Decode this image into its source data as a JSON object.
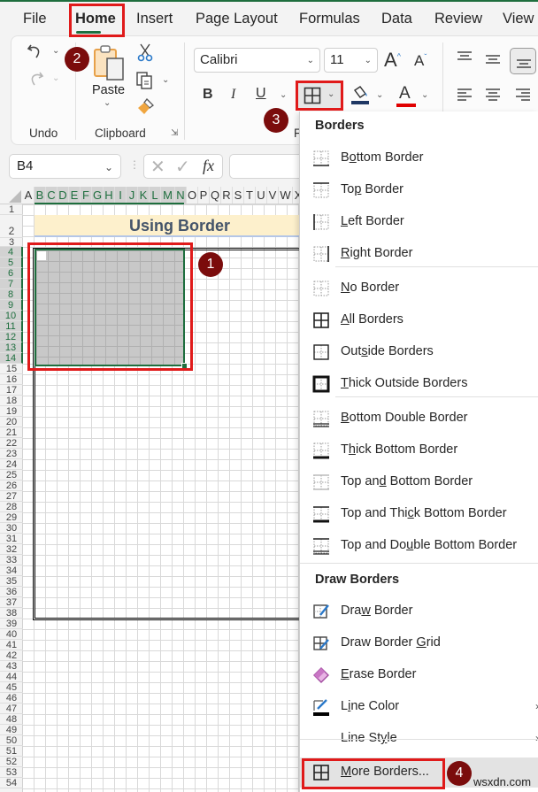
{
  "ribbon_tabs": [
    {
      "label": "File"
    },
    {
      "label": "Home",
      "active": true
    },
    {
      "label": "Insert"
    },
    {
      "label": "Page Layout"
    },
    {
      "label": "Formulas"
    },
    {
      "label": "Data"
    },
    {
      "label": "Review"
    },
    {
      "label": "View"
    }
  ],
  "ribbon": {
    "undo_group_label": "Undo",
    "clipboard_group_label": "Clipboard",
    "paste_label": "Paste",
    "font_name": "Calibri",
    "font_size": "11",
    "font_group_label_partial": "F",
    "icons": {
      "undo": "undo-icon",
      "redo": "redo-icon",
      "paste": "paste-icon",
      "cut": "scissors-icon",
      "copy": "copy-icon",
      "format_painter": "paintbrush-icon",
      "increase_font": "increase-font-size-icon",
      "decrease_font": "decrease-font-size-icon",
      "bold": "B",
      "italic": "I",
      "underline": "U",
      "borders": "borders-icon",
      "fill_color": "fill-color-icon",
      "font_color": "A"
    },
    "fill_color": "#1f3864",
    "font_color": "#e00000"
  },
  "formula_bar": {
    "name_box": "B4",
    "fx_label": "fx",
    "formula_value": ""
  },
  "sheet": {
    "columns": [
      "A",
      "B",
      "C",
      "D",
      "E",
      "F",
      "G",
      "H",
      "I",
      "J",
      "K",
      "L",
      "M",
      "N",
      "O",
      "P",
      "Q",
      "R",
      "S",
      "T",
      "U",
      "V",
      "W",
      "X"
    ],
    "selected_columns": [
      "B",
      "C",
      "D",
      "E",
      "F",
      "G",
      "H",
      "I",
      "J",
      "K",
      "L",
      "M",
      "N"
    ],
    "rows": [
      "1",
      "2",
      "3",
      "4",
      "5",
      "6",
      "7",
      "8",
      "9",
      "10",
      "11",
      "12",
      "13",
      "14",
      "15",
      "16",
      "17",
      "18",
      "19",
      "20",
      "21",
      "22",
      "23",
      "24",
      "25",
      "26",
      "27",
      "28",
      "29",
      "30",
      "31",
      "32",
      "33",
      "34",
      "35",
      "36",
      "37",
      "38",
      "39",
      "40",
      "41",
      "42",
      "43",
      "44",
      "45",
      "46",
      "47",
      "48",
      "49",
      "50",
      "51",
      "52",
      "53",
      "54"
    ],
    "selected_rows": [
      "4",
      "5",
      "6",
      "7",
      "8",
      "9",
      "10",
      "11",
      "12",
      "13",
      "14"
    ],
    "title_cell": "Using Border",
    "title_fill": "#fdf0cc",
    "selection_range_active": "B4"
  },
  "borders_menu": {
    "section1_header": "Borders",
    "section1_items": [
      {
        "pre": "B",
        "u": "o",
        "post": "ttom Border",
        "icon": "bottom-border-icon"
      },
      {
        "pre": "To",
        "u": "p",
        "post": " Border",
        "icon": "top-border-icon"
      },
      {
        "pre": "",
        "u": "L",
        "post": "eft Border",
        "icon": "left-border-icon"
      },
      {
        "pre": "",
        "u": "R",
        "post": "ight Border",
        "icon": "right-border-icon"
      }
    ],
    "section2_items": [
      {
        "pre": "",
        "u": "N",
        "post": "o Border",
        "icon": "no-border-icon"
      },
      {
        "pre": "",
        "u": "A",
        "post": "ll Borders",
        "icon": "all-borders-icon"
      },
      {
        "pre": "Out",
        "u": "s",
        "post": "ide Borders",
        "icon": "outside-borders-icon"
      },
      {
        "pre": "",
        "u": "T",
        "post": "hick Outside Borders",
        "icon": "thick-outside-borders-icon"
      }
    ],
    "section3_items": [
      {
        "pre": "",
        "u": "B",
        "post": "ottom Double Border",
        "icon": "bottom-double-border-icon"
      },
      {
        "pre": "T",
        "u": "h",
        "post": "ick Bottom Border",
        "icon": "thick-bottom-border-icon"
      },
      {
        "pre": "Top an",
        "u": "d",
        "post": " Bottom Border",
        "icon": "top-and-bottom-border-icon"
      },
      {
        "pre": "Top and Thi",
        "u": "c",
        "post": "k Bottom Border",
        "icon": "top-and-thick-bottom-border-icon"
      },
      {
        "pre": "Top and Do",
        "u": "u",
        "post": "ble Bottom Border",
        "icon": "top-and-double-bottom-border-icon"
      }
    ],
    "section4_header": "Draw Borders",
    "section4_items": [
      {
        "pre": "Dra",
        "u": "w",
        "post": " Border",
        "icon": "draw-border-icon"
      },
      {
        "pre": "Draw Border ",
        "u": "G",
        "post": "rid",
        "icon": "draw-border-grid-icon"
      },
      {
        "pre": "",
        "u": "E",
        "post": "rase Border",
        "icon": "eraser-icon"
      },
      {
        "pre": "L",
        "u": "i",
        "post": "ne Color",
        "icon": "line-color-icon",
        "submenu": true
      },
      {
        "pre": "Line St",
        "u": "y",
        "post": "le",
        "icon": "",
        "submenu": true
      },
      {
        "pre": "",
        "u": "M",
        "post": "ore Borders...",
        "icon": "all-borders-icon",
        "highlighted": true
      }
    ]
  },
  "callouts": [
    {
      "number": "1"
    },
    {
      "number": "2"
    },
    {
      "number": "3"
    },
    {
      "number": "4"
    }
  ],
  "watermark": "wsxdn.com",
  "colors": {
    "excel_green": "#1e6e3e",
    "callout_red": "#e01a1a",
    "badge_bg": "#7b0c0c",
    "selection_fill": "#c8c8c8"
  }
}
